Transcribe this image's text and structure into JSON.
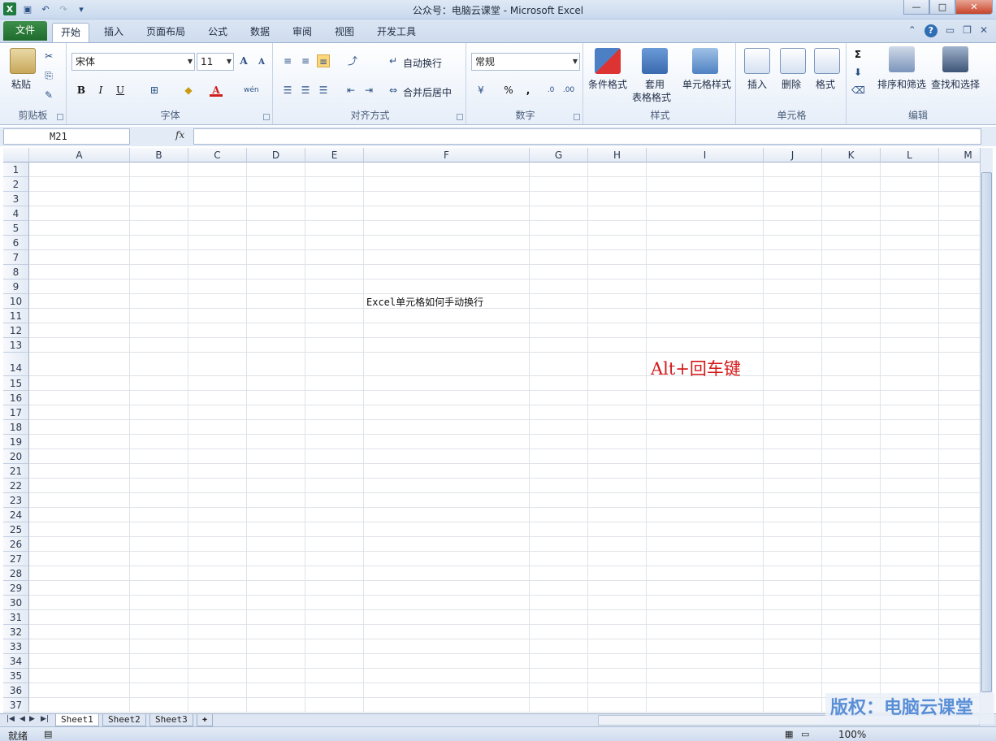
{
  "window": {
    "title": "公众号：电脑云课堂 - Microsoft Excel"
  },
  "tabs": [
    "文件",
    "开始",
    "插入",
    "页面布局",
    "公式",
    "数据",
    "审阅",
    "视图",
    "开发工具"
  ],
  "ribbon": {
    "clipboard": {
      "paste": "粘贴",
      "label": "剪贴板"
    },
    "font": {
      "name": "宋体",
      "size": "11",
      "label": "字体",
      "bold": "B",
      "italic": "I",
      "underline": "U",
      "grow": "A",
      "shrink": "A",
      "fontcolor": "A",
      "phonetic": "wén"
    },
    "alignment": {
      "wrap": "自动换行",
      "merge": "合并后居中",
      "label": "对齐方式"
    },
    "number": {
      "format": "常规",
      "percent": "%",
      "comma": ",",
      "label": "数字"
    },
    "styles": {
      "conditional": "条件格式",
      "table_line1": "套用",
      "table_line2": "表格格式",
      "cellstyle": "单元格样式",
      "label": "样式"
    },
    "cells": {
      "insert": "插入",
      "delete": "删除",
      "format": "格式",
      "label": "单元格"
    },
    "editing": {
      "sum": "Σ",
      "sort": "排序和筛选",
      "find": "查找和选择",
      "label": "编辑"
    }
  },
  "formula_bar": {
    "name_box": "M21",
    "fx": "fx",
    "value": ""
  },
  "grid": {
    "columns": [
      "A",
      "B",
      "C",
      "D",
      "E",
      "F",
      "G",
      "H",
      "I",
      "J",
      "K",
      "L",
      "M"
    ],
    "rows": [
      "1",
      "2",
      "3",
      "4",
      "5",
      "6",
      "7",
      "8",
      "9",
      "10",
      "11",
      "12",
      "13",
      "14",
      "15",
      "16",
      "17",
      "18",
      "19",
      "20",
      "21",
      "22",
      "23",
      "24",
      "25",
      "26",
      "27",
      "28",
      "29",
      "30",
      "31",
      "32",
      "33",
      "34",
      "35",
      "36",
      "37"
    ],
    "cell_F10": "Excel单元格如何手动换行",
    "annotation": "Alt+回车键"
  },
  "sheets": [
    "Sheet1",
    "Sheet2",
    "Sheet3"
  ],
  "status": {
    "ready": "就绪",
    "zoom": "100%"
  },
  "watermark": "版权：电脑云课堂",
  "colors": {
    "file_tab": "#1f6b2c",
    "annotation": "#d41a1a",
    "watermark": "#5a8fd6"
  }
}
